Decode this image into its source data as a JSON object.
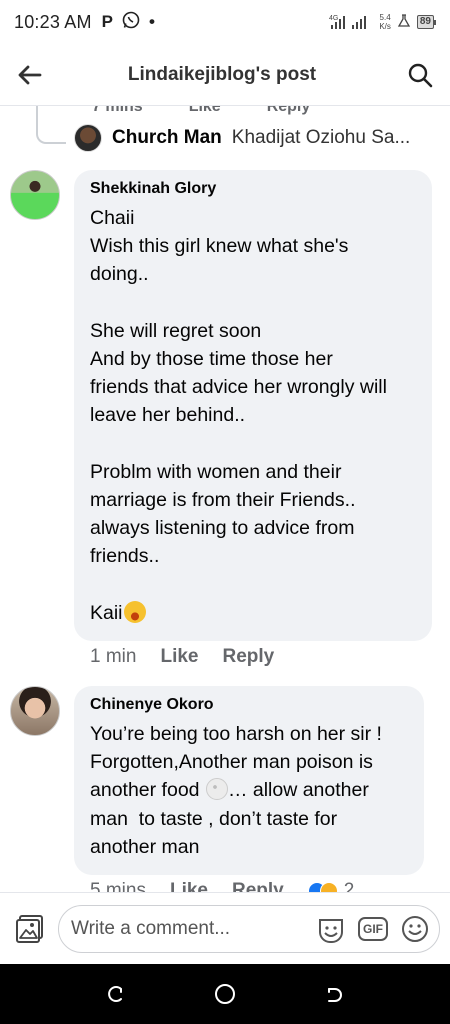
{
  "status_bar": {
    "time": "10:23 AM",
    "app_icons": [
      "P",
      "whatsapp-icon",
      "•"
    ],
    "network": "4G",
    "speed_value": "5.4",
    "speed_unit": "K/s",
    "battery": "89"
  },
  "header": {
    "title": "Lindaikejiblog's post"
  },
  "thread": {
    "cut_actions": [
      "7 mins",
      "Like",
      "Reply"
    ],
    "reply_preview": {
      "name": "Church Man",
      "text": "Khadijat Oziohu Sa..."
    }
  },
  "comments": [
    {
      "author": "Shekkinah Glory",
      "lines": [
        "Chaii",
        "Wish this girl knew what she's",
        "doing..",
        "",
        "She will regret soon",
        "And by those time those her",
        "friends that advice her wrongly will",
        "leave her behind..",
        "",
        "Problm with women and their",
        "marriage is from their Friends..",
        "always listening to advice from",
        "friends..",
        "",
        "Kaii"
      ],
      "time": "1 min",
      "like_label": "Like",
      "reply_label": "Reply"
    },
    {
      "author": "Chinenye Okoro",
      "lines": [
        "You’re being too harsh on her sir !",
        "Forgotten,Another man poison is",
        "another food",
        "… allow another",
        "man  to taste , don’t taste for",
        "another man"
      ],
      "time": "5 mins",
      "like_label": "Like",
      "reply_label": "Reply",
      "reaction_count": "2"
    }
  ],
  "composer": {
    "placeholder": "Write a comment...",
    "gif_label": "GIF"
  },
  "colors": {
    "bubble": "#f0f2f5",
    "meta_text": "#65676b",
    "like_blue": "#1877f2"
  }
}
